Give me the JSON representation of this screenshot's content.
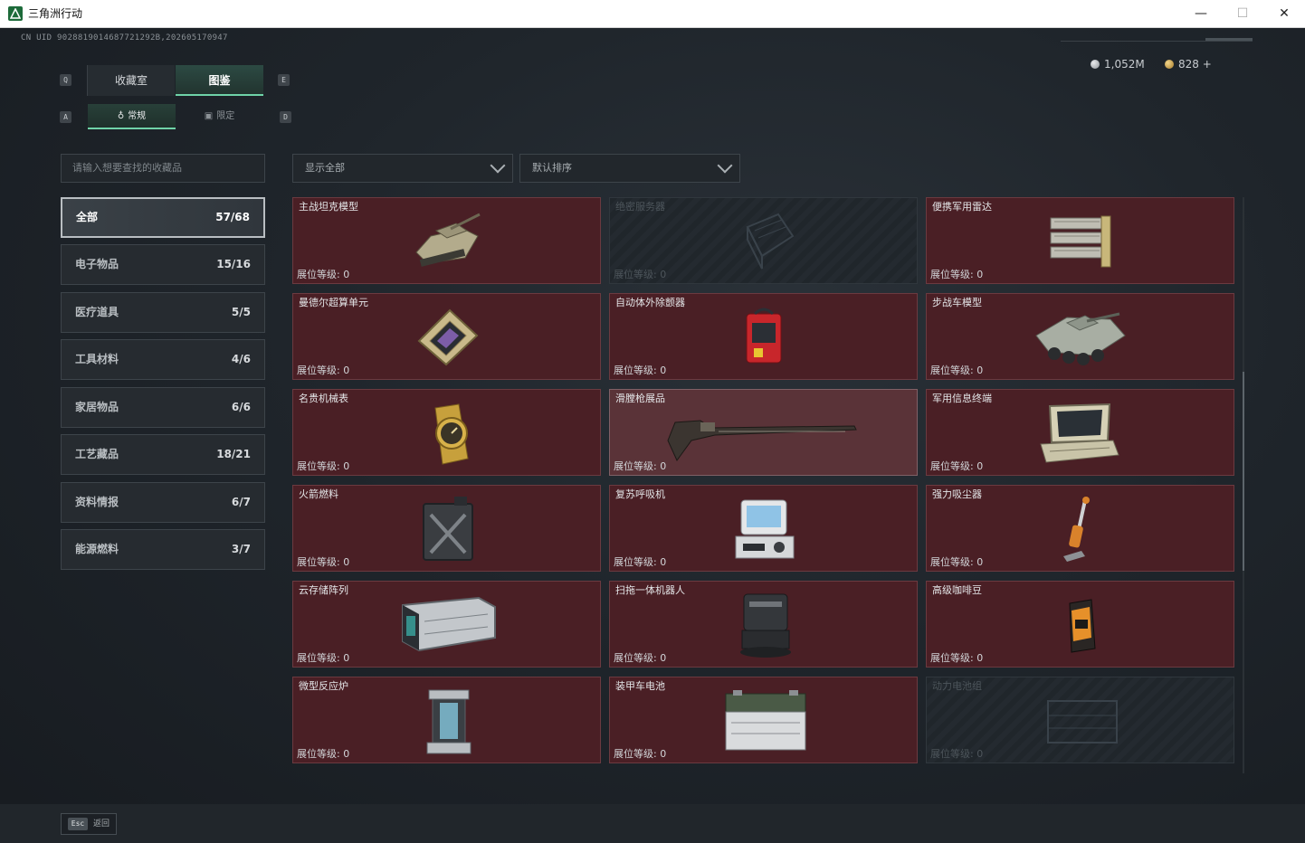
{
  "window": {
    "title": "三角洲行动",
    "minimize": "—",
    "maximize": "☐",
    "close": "✕"
  },
  "header": {
    "uid": "CN UID 9028819014687721292B,202605170947",
    "currency_silver": "1,052M",
    "currency_gold": "828 +"
  },
  "tabs": {
    "key_left": "Q",
    "key_right": "E",
    "main": [
      {
        "label": "收藏室",
        "active": false
      },
      {
        "label": "图鉴",
        "active": true
      }
    ],
    "sub_key_left": "A",
    "sub_key_right": "D",
    "sub": [
      {
        "label": "常规",
        "active": true
      },
      {
        "label": "限定",
        "active": false
      }
    ]
  },
  "search": {
    "placeholder": "请输入想要查找的收藏品"
  },
  "filters": {
    "show": "显示全部",
    "sort": "默认排序"
  },
  "categories": [
    {
      "label": "全部",
      "count": "57/68",
      "active": true
    },
    {
      "label": "电子物品",
      "count": "15/16"
    },
    {
      "label": "医疗道具",
      "count": "5/5"
    },
    {
      "label": "工具材料",
      "count": "4/6"
    },
    {
      "label": "家居物品",
      "count": "6/6"
    },
    {
      "label": "工艺藏品",
      "count": "18/21"
    },
    {
      "label": "资料情报",
      "count": "6/7"
    },
    {
      "label": "能源燃料",
      "count": "3/7"
    }
  ],
  "items": [
    {
      "name": "主战坦克模型",
      "level": "展位等级: 0",
      "icon": "tank-icon"
    },
    {
      "name": "绝密服务器",
      "level": "展位等级: 0",
      "icon": "server-icon",
      "locked": true
    },
    {
      "name": "便携军用雷达",
      "level": "展位等级: 0",
      "icon": "radar-icon"
    },
    {
      "name": "曼德尔超算单元",
      "level": "展位等级: 0",
      "icon": "chip-icon"
    },
    {
      "name": "自动体外除颤器",
      "level": "展位等级: 0",
      "icon": "defibrillator-icon"
    },
    {
      "name": "步战车模型",
      "level": "展位等级: 0",
      "icon": "apc-icon"
    },
    {
      "name": "名贵机械表",
      "level": "展位等级: 0",
      "icon": "watch-icon"
    },
    {
      "name": "滑膛枪展品",
      "level": "展位等级: 0",
      "icon": "musket-icon",
      "highlight": true
    },
    {
      "name": "军用信息终端",
      "level": "展位等级: 0",
      "icon": "terminal-icon"
    },
    {
      "name": "火箭燃料",
      "level": "展位等级: 0",
      "icon": "fuel-can-icon"
    },
    {
      "name": "复苏呼吸机",
      "level": "展位等级: 0",
      "icon": "ventilator-icon"
    },
    {
      "name": "强力吸尘器",
      "level": "展位等级: 0",
      "icon": "vacuum-icon"
    },
    {
      "name": "云存储阵列",
      "level": "展位等级: 0",
      "icon": "storage-array-icon"
    },
    {
      "name": "扫拖一体机器人",
      "level": "展位等级: 0",
      "icon": "robot-vacuum-icon"
    },
    {
      "name": "高级咖啡豆",
      "level": "展位等级: 0",
      "icon": "coffee-bag-icon"
    },
    {
      "name": "微型反应炉",
      "level": "展位等级: 0",
      "icon": "reactor-icon"
    },
    {
      "name": "装甲车电池",
      "level": "展位等级: 0",
      "icon": "battery-icon"
    },
    {
      "name": "动力电池组",
      "level": "展位等级: 0",
      "icon": "power-pack-icon",
      "locked": true
    }
  ],
  "footer": {
    "esc_key": "Esc",
    "back_label": "返回"
  }
}
